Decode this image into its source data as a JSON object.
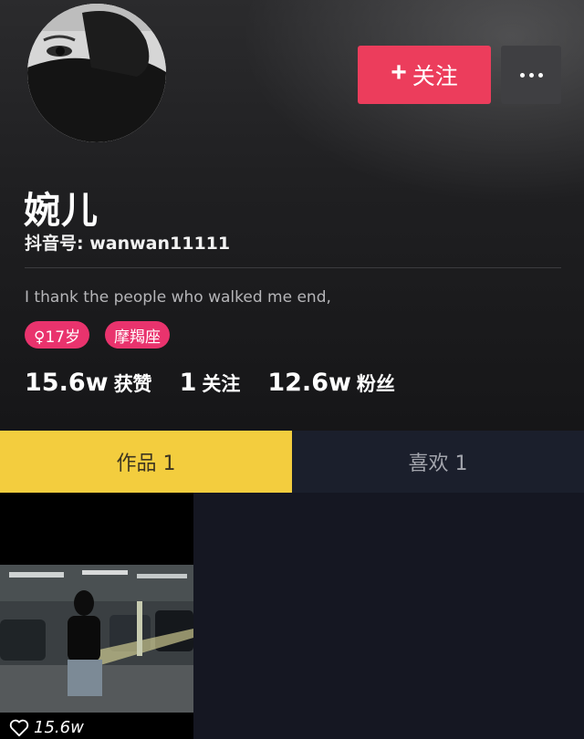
{
  "profile": {
    "name": "婉儿",
    "douyin_id": "抖音号: wanwan11111",
    "bio": "I thank the people who walked me  end,",
    "tags": {
      "age": "♀17岁",
      "zodiac": "摩羯座"
    }
  },
  "actions": {
    "follow_label": "关注",
    "follow_icon": "plus-icon",
    "more_icon": "ellipsis-icon"
  },
  "stats": {
    "likes_value": "15.6w",
    "likes_label": "获赞",
    "following_value": "1",
    "following_label": "关注",
    "fans_value": "12.6w",
    "fans_label": "粉丝"
  },
  "tabs": {
    "works": "作品 1",
    "likes": "喜欢 1"
  },
  "videos": [
    {
      "like_count": "15.6w",
      "icon": "heart-outline-icon"
    }
  ],
  "colors": {
    "follow_button": "#ec3d5c",
    "tag": "#e9336d",
    "active_tab": "#f3cd3e",
    "inactive_tab": "#1b1f2c"
  }
}
